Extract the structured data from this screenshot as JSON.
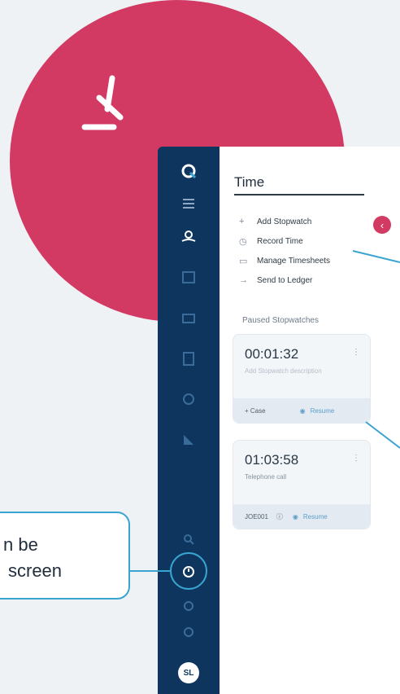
{
  "colors": {
    "accent": "#d33a63",
    "sidebar": "#0e355e",
    "highlight": "#3aa4d1",
    "resume": "#5b9ec9"
  },
  "panel": {
    "title": "Time"
  },
  "menu": [
    {
      "icon": "plus-icon",
      "glyph": "+",
      "label": "Add Stopwatch"
    },
    {
      "icon": "clock-icon",
      "glyph": "◷",
      "label": "Record Time"
    },
    {
      "icon": "timesheet-icon",
      "glyph": "▭",
      "label": "Manage Timesheets"
    },
    {
      "icon": "arrow-right-icon",
      "glyph": "→",
      "label": "Send to Ledger"
    }
  ],
  "section_title": "Paused Stopwatches",
  "stopwatches": [
    {
      "time": "00:01:32",
      "description": "Add Stopwatch description",
      "left_action": "+ Case",
      "right_action": "Resume"
    },
    {
      "time": "01:03:58",
      "description": "Telephone call",
      "left_action": "JOE001",
      "right_action": "Resume"
    }
  ],
  "tooltip": {
    "line1": "n be",
    "line2": "screen"
  },
  "user": {
    "initials": "SL"
  }
}
